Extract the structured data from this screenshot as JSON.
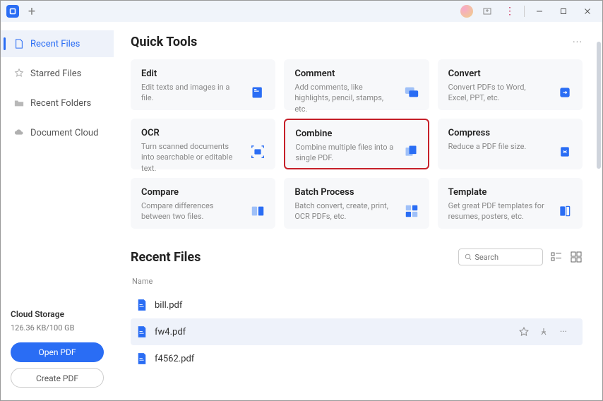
{
  "titlebar": {
    "plus": "+"
  },
  "sidebar": {
    "items": [
      {
        "label": "Recent Files"
      },
      {
        "label": "Starred Files"
      },
      {
        "label": "Recent Folders"
      },
      {
        "label": "Document Cloud"
      }
    ]
  },
  "cloud": {
    "title": "Cloud Storage",
    "quota": "126.36 KB/100 GB",
    "open": "Open PDF",
    "create": "Create PDF"
  },
  "quicktools": {
    "title": "Quick Tools",
    "more": "···",
    "cards": [
      {
        "title": "Edit",
        "desc": "Edit texts and images in a file."
      },
      {
        "title": "Comment",
        "desc": "Add comments, like highlights, pencil, stamps, etc."
      },
      {
        "title": "Convert",
        "desc": "Convert PDFs to Word, Excel, PPT, etc."
      },
      {
        "title": "OCR",
        "desc": "Turn scanned documents into searchable or editable text."
      },
      {
        "title": "Combine",
        "desc": "Combine multiple files into a single PDF."
      },
      {
        "title": "Compress",
        "desc": "Reduce a PDF file size."
      },
      {
        "title": "Compare",
        "desc": "Compare differences between two files."
      },
      {
        "title": "Batch Process",
        "desc": "Batch convert, create, print, OCR PDFs, etc."
      },
      {
        "title": "Template",
        "desc": "Get great PDF templates for resumes, posters, etc."
      }
    ]
  },
  "recent": {
    "title": "Recent Files",
    "search_placeholder": "Search",
    "col_name": "Name",
    "files": [
      {
        "name": "bill.pdf"
      },
      {
        "name": "fw4.pdf"
      },
      {
        "name": "f4562.pdf"
      }
    ]
  }
}
